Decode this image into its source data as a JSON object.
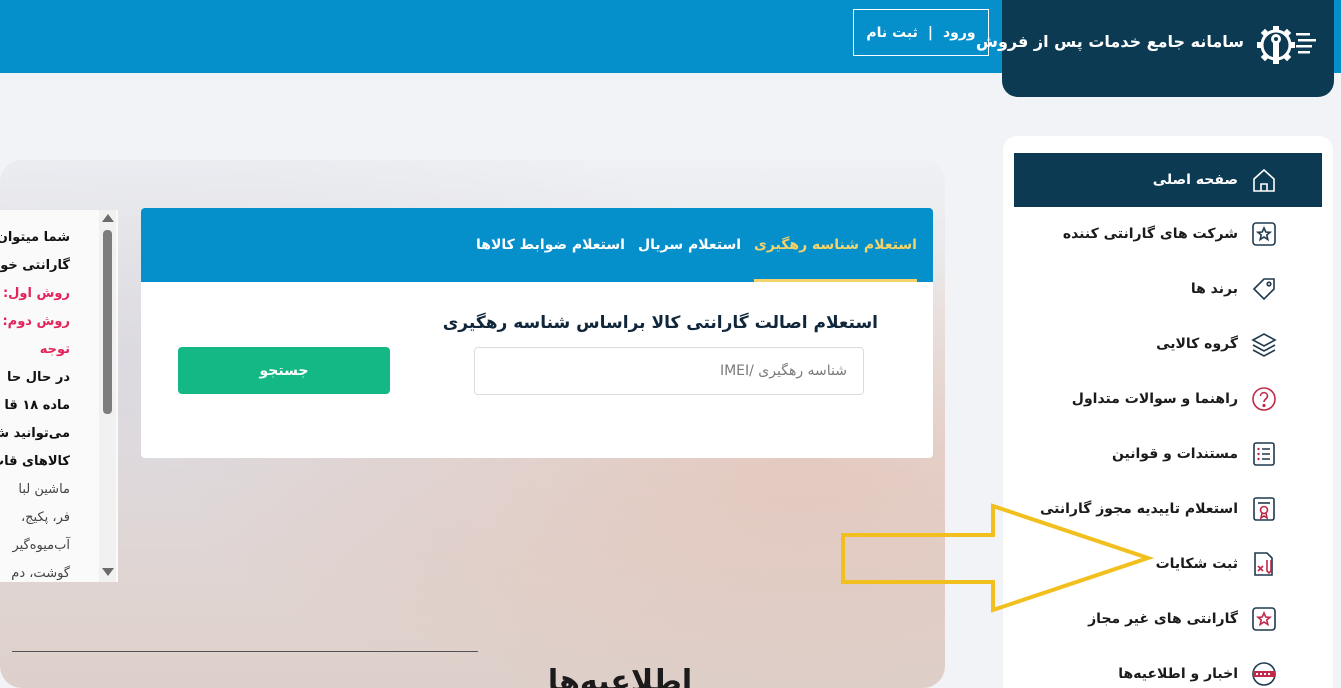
{
  "header": {
    "brand_title": "سامانه جامع خدمات پس از فروش",
    "login_label": "ورود",
    "separator": "|",
    "register_label": "ثبت نام"
  },
  "sidebar": {
    "items": [
      {
        "label": "صفحه اصلی",
        "icon": "home-icon",
        "active": true
      },
      {
        "label": "شرکت های گارانتی کننده",
        "icon": "badge-star-icon"
      },
      {
        "label": "برند ها",
        "icon": "tag-icon"
      },
      {
        "label": "گروه کالایی",
        "icon": "layers-icon"
      },
      {
        "label": "راهنما و سوالات متداول",
        "icon": "question-icon"
      },
      {
        "label": "مستندات و قوانین",
        "icon": "document-list-icon"
      },
      {
        "label": "استعلام تاییدیه مجوز گارانتی",
        "icon": "certificate-icon"
      },
      {
        "label": "ثبت شکایات",
        "icon": "complaint-pen-icon"
      },
      {
        "label": "گارانتی های غیر مجاز",
        "icon": "badge-star-icon"
      },
      {
        "label": "اخبار و اطلاعیه‌ها",
        "icon": "news-icon"
      }
    ]
  },
  "search_card": {
    "tabs": [
      {
        "label": "استعلام شناسه رهگیری",
        "active": true
      },
      {
        "label": "استعلام سریال"
      },
      {
        "label": "استعلام ضوابط کالاها"
      }
    ],
    "title": "استعلام اصالت گارانتی کالا براساس شناسه رهگیری",
    "input_placeholder": "شناسه رهگیری /IMEI",
    "input_value": "",
    "button_label": "جستجو"
  },
  "notice": {
    "line1": "شما میتوان",
    "line2": "گارانتی خو",
    "line3": "روش اول: ",
    "line4": "روش دوم: ",
    "line5": "توجه",
    "line6": "در حال حا",
    "line7": "ماده ۱۸ قا",
    "line8": "می‌توانید ش",
    "line9": "کالاهای قاب",
    "line10": "ماشین لبا",
    "line11": "فر، پکیج، ",
    "line12": "آب‌میوه‌گیر",
    "line13": "گوشت، دم"
  },
  "news": {
    "heading": "اطلاعیه‌ها"
  },
  "colors": {
    "primary_blue": "#0590cc",
    "dark_navy": "#0b3a52",
    "accent_yellow": "#f4d36a",
    "search_green": "#14b885",
    "notice_pink": "#e2245a",
    "arrow_yellow": "#f2c01e"
  }
}
